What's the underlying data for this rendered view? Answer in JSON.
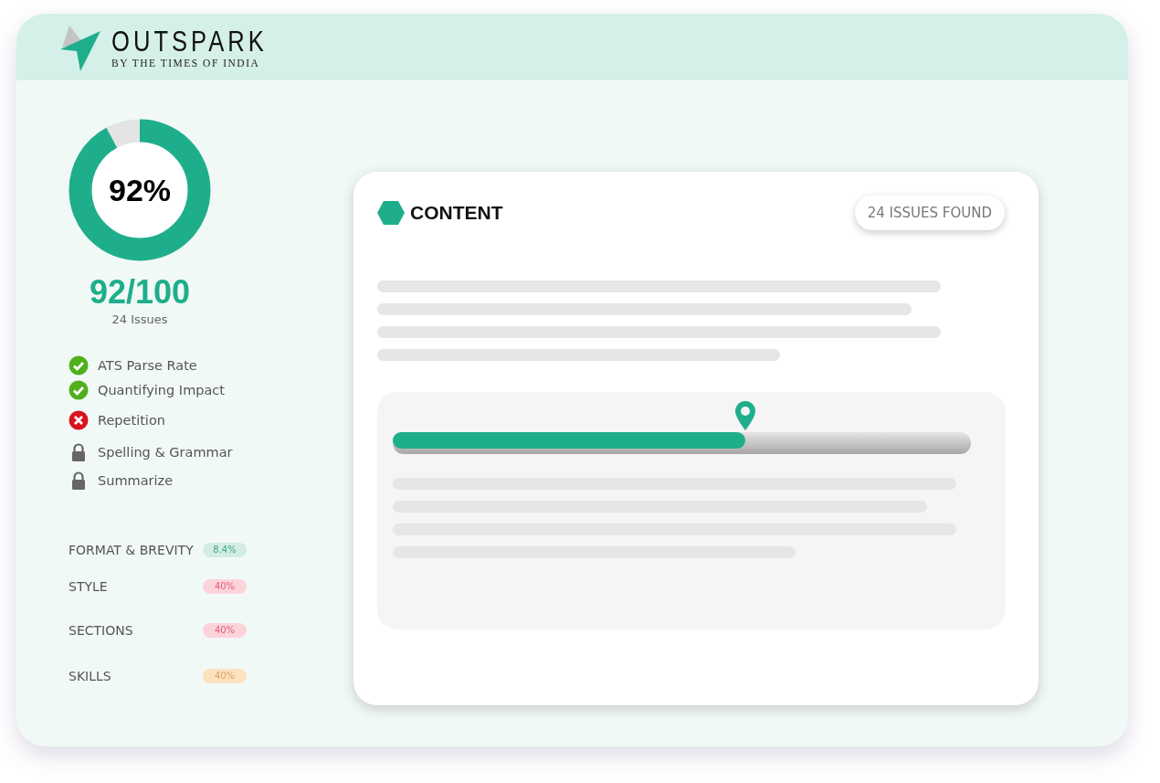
{
  "brand": {
    "name": "OUTSPARK",
    "tagline": "BY THE TIMES OF INDIA"
  },
  "score": {
    "level": 0.92,
    "percent": "92%",
    "total": "92/100",
    "issues": "24 Issues"
  },
  "checklist": [
    {
      "label": "ATS Parse Rate",
      "kind": "pass"
    },
    {
      "label": "Quantifying Impact",
      "kind": "pass"
    },
    {
      "label": "Repetition",
      "kind": "fail"
    },
    {
      "label": "Spelling & Grammar",
      "kind": "locked"
    },
    {
      "label": "Summarize",
      "kind": "locked"
    }
  ],
  "categories": [
    {
      "label": "FORMAT & BREVITY",
      "value": "8.4%",
      "color": "#d3ede4"
    },
    {
      "label": "STYLE",
      "value": "40%",
      "color": "#fcd3db"
    },
    {
      "label": "SECTIONS",
      "value": "40%",
      "color": "#fcd3db"
    },
    {
      "label": "SKILLS",
      "value": "40%",
      "color": "#fde2bf"
    }
  ],
  "content_card": {
    "title": "CONTENT",
    "badge": "24 ISSUES FOUND",
    "progress": {
      "level": 0.61
    }
  }
}
